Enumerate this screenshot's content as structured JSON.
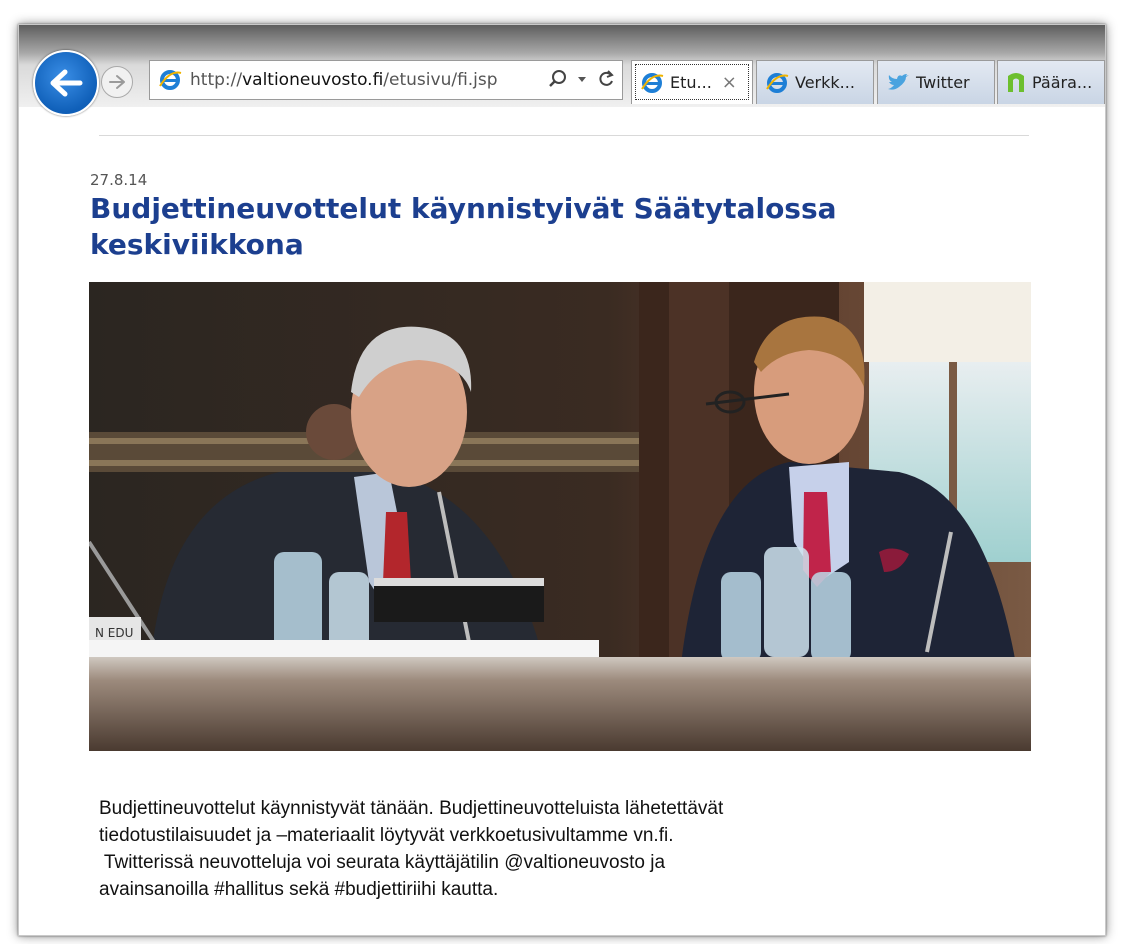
{
  "browser": {
    "url_prefix": "http://",
    "url_domain": "valtioneuvosto.fi",
    "url_path": "/etusivu/fi.jsp",
    "tabs": [
      {
        "label": "Etu...",
        "active": true,
        "icon": "ie-icon"
      },
      {
        "label": "Verkk...",
        "active": false,
        "icon": "ie-icon"
      },
      {
        "label": "Twitter",
        "active": false,
        "icon": "twitter-bird-icon"
      },
      {
        "label": "Päära...",
        "active": false,
        "icon": "green-n-icon"
      }
    ],
    "close_glyph": "×"
  },
  "article": {
    "date": "27.8.14",
    "headline": "Budjettineuvottelut käynnistyivät Säätytalossa keskiviikkona",
    "photo_placard": "N EDU",
    "body_lines": [
      "Budjettineuvottelut käynnistyvät tänään. Budjettineuvotteluista lähetettävät",
      "tiedotustilaisuudet ja –materiaalit löytyvät verkkoetusivultamme vn.fi.",
      " Twitterissä neuvotteluja voi seurata käyttäjätilin @valtioneuvosto ja",
      "avainsanoilla #hallitus sekä #budjettiriihi kautta."
    ]
  },
  "colors": {
    "headline": "#1c3f8f",
    "back_button": "#1f74d1",
    "twitter": "#4aa3df",
    "green_n": "#6cbf2e"
  }
}
